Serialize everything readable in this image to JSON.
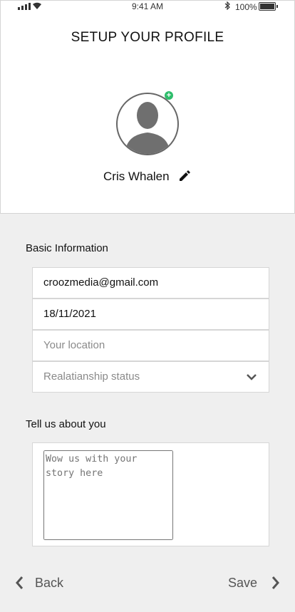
{
  "status_bar": {
    "time": "9:41 AM",
    "battery_percent": "100%"
  },
  "header": {
    "title": "SETUP YOUR PROFILE"
  },
  "profile": {
    "name": "Cris Whalen"
  },
  "basic_info": {
    "label": "Basic Information",
    "email": "croozmedia@gmail.com",
    "date": "18/11/2021",
    "location_placeholder": "Your location",
    "relationship_placeholder": "Realatianship status"
  },
  "about": {
    "label": "Tell us about you",
    "placeholder": "Wow us with your story here"
  },
  "footer": {
    "back_label": "Back",
    "save_label": "Save"
  },
  "colors": {
    "add_badge": "#2ebd6b",
    "background": "#efefef"
  }
}
